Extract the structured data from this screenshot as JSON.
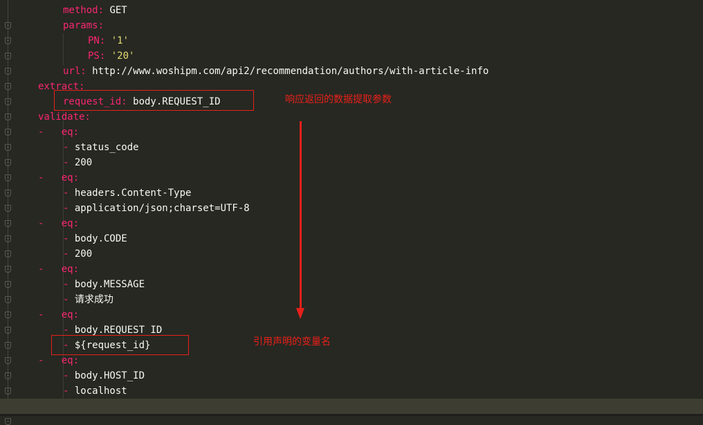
{
  "editor": {
    "lines": [
      {
        "parts": [
          {
            "t": "method:",
            "c": "k"
          },
          {
            "t": " GET",
            "c": "v"
          }
        ],
        "indent": 91
      },
      {
        "parts": [
          {
            "t": "params:",
            "c": "k"
          }
        ],
        "indent": 91
      },
      {
        "parts": [
          {
            "t": "PN:",
            "c": "k"
          },
          {
            "t": " '1'",
            "c": "s"
          }
        ],
        "indent": 127
      },
      {
        "parts": [
          {
            "t": "PS:",
            "c": "k"
          },
          {
            "t": " '20'",
            "c": "s"
          }
        ],
        "indent": 127
      },
      {
        "parts": [
          {
            "t": "url:",
            "c": "k"
          },
          {
            "t": " http://www.woshipm.com/api2/recommendation/authors/with-article-info",
            "c": "v"
          }
        ],
        "indent": 91
      },
      {
        "parts": [
          {
            "t": "extract:",
            "c": "k"
          }
        ],
        "indent": 55
      },
      {
        "parts": [
          {
            "t": "request_id:",
            "c": "k"
          },
          {
            "t": " body.REQUEST_ID",
            "c": "v"
          }
        ],
        "indent": 91
      },
      {
        "parts": [
          {
            "t": "validate:",
            "c": "k"
          }
        ],
        "indent": 55
      },
      {
        "parts": [
          {
            "t": "-   eq:",
            "c": "k"
          }
        ],
        "indent": 55
      },
      {
        "parts": [
          {
            "t": "- ",
            "c": "k"
          },
          {
            "t": "status_code",
            "c": "v"
          }
        ],
        "indent": 91
      },
      {
        "parts": [
          {
            "t": "- ",
            "c": "k"
          },
          {
            "t": "200",
            "c": "v"
          }
        ],
        "indent": 91
      },
      {
        "parts": [
          {
            "t": "-   eq:",
            "c": "k"
          }
        ],
        "indent": 55
      },
      {
        "parts": [
          {
            "t": "- ",
            "c": "k"
          },
          {
            "t": "headers.Content-Type",
            "c": "v"
          }
        ],
        "indent": 91
      },
      {
        "parts": [
          {
            "t": "- ",
            "c": "k"
          },
          {
            "t": "application/json;charset=UTF-8",
            "c": "v"
          }
        ],
        "indent": 91
      },
      {
        "parts": [
          {
            "t": "-   eq:",
            "c": "k"
          }
        ],
        "indent": 55
      },
      {
        "parts": [
          {
            "t": "- ",
            "c": "k"
          },
          {
            "t": "body.CODE",
            "c": "v"
          }
        ],
        "indent": 91
      },
      {
        "parts": [
          {
            "t": "- ",
            "c": "k"
          },
          {
            "t": "200",
            "c": "v"
          }
        ],
        "indent": 91
      },
      {
        "parts": [
          {
            "t": "-   eq:",
            "c": "k"
          }
        ],
        "indent": 55
      },
      {
        "parts": [
          {
            "t": "- ",
            "c": "k"
          },
          {
            "t": "body.MESSAGE",
            "c": "v"
          }
        ],
        "indent": 91
      },
      {
        "parts": [
          {
            "t": "- ",
            "c": "k"
          },
          {
            "t": "请求成功",
            "c": "v"
          }
        ],
        "indent": 91
      },
      {
        "parts": [
          {
            "t": "-   eq:",
            "c": "k"
          }
        ],
        "indent": 55
      },
      {
        "parts": [
          {
            "t": "- ",
            "c": "k"
          },
          {
            "t": "body.REQUEST_ID",
            "c": "v"
          }
        ],
        "indent": 91
      },
      {
        "parts": [
          {
            "t": "- ",
            "c": "k"
          },
          {
            "t": "${request_id}",
            "c": "v"
          }
        ],
        "indent": 91
      },
      {
        "parts": [
          {
            "t": "-   eq:",
            "c": "k"
          }
        ],
        "indent": 55
      },
      {
        "parts": [
          {
            "t": "- ",
            "c": "k"
          },
          {
            "t": "body.HOST_ID",
            "c": "v"
          }
        ],
        "indent": 91
      },
      {
        "parts": [
          {
            "t": "- ",
            "c": "k"
          },
          {
            "t": "localhost",
            "c": "v"
          }
        ],
        "indent": 91
      },
      {
        "parts": [],
        "indent": 91
      }
    ]
  },
  "annotations": {
    "extract_note": "响应返回的数据提取参数",
    "reference_note": "引用声明的变量名"
  }
}
